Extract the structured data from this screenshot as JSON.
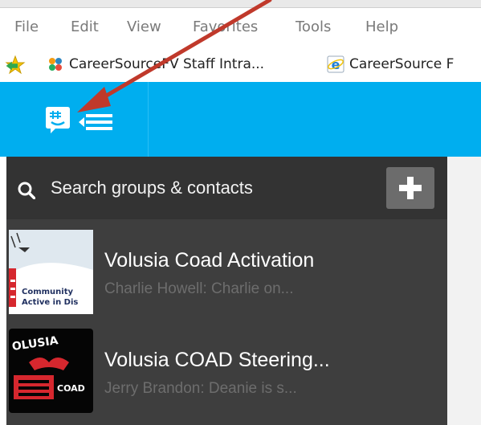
{
  "browser": {
    "menu": [
      "File",
      "Edit",
      "View",
      "Favorites",
      "Tools",
      "Help"
    ],
    "favorites": [
      {
        "label": "CareerSourceFV Staff Intra...",
        "icon": "colorful-flower-favicon"
      },
      {
        "label": "CareerSource F",
        "icon": "internet-explorer-icon"
      }
    ]
  },
  "app": {
    "logo_icon": "groupme-logo-icon",
    "menu_icon": "hamburger-menu-icon",
    "accent": "#00aeef",
    "search": {
      "placeholder": "Search groups & contacts",
      "add_icon": "plus-icon"
    },
    "groups": [
      {
        "name": "Volusia Coad Activation",
        "preview": "Charlie Howell: Charlie on...",
        "avatar_text": [
          "Community",
          "Active in Dis"
        ]
      },
      {
        "name": "Volusia COAD Steering...",
        "preview": "Jerry Brandon: Deanie is s...",
        "avatar_text": [
          "OLUSIA",
          "COAD"
        ]
      }
    ]
  },
  "annotation": {
    "arrow_color": "#c0392b"
  }
}
